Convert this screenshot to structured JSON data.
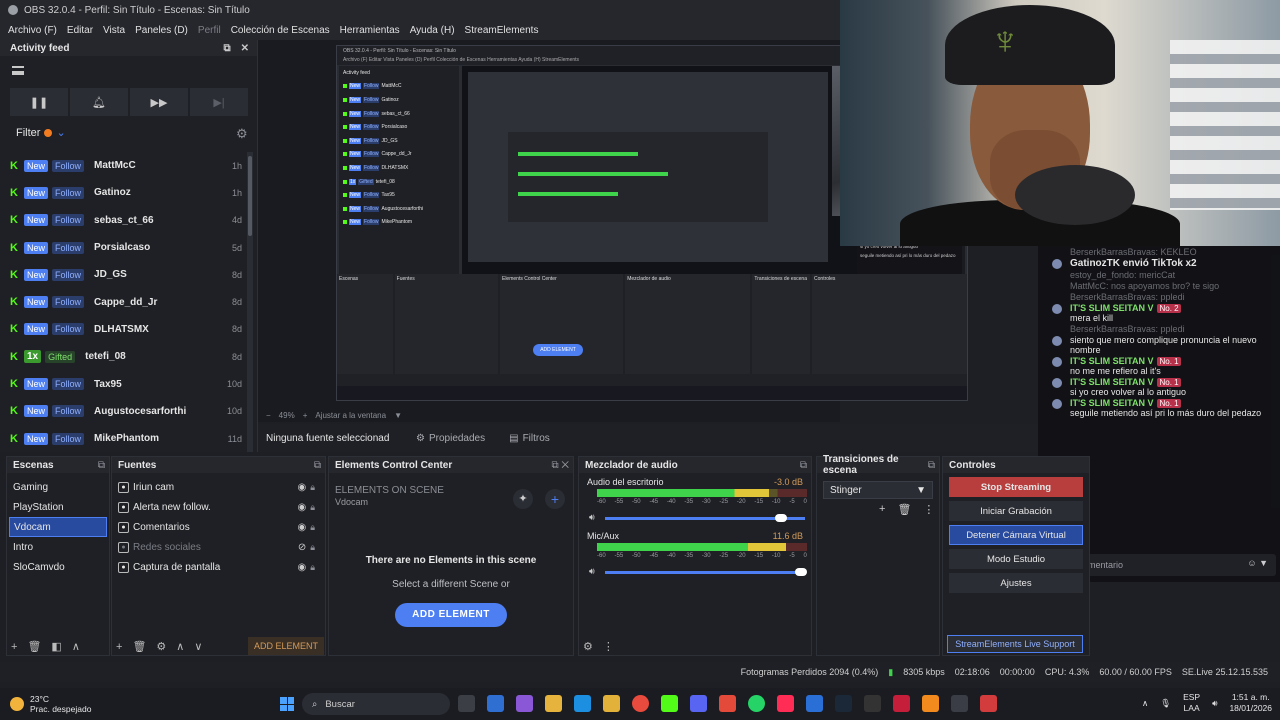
{
  "window": {
    "title": "OBS 32.0.4 - Perfil: Sin Título - Escenas: Sin Título"
  },
  "menu": [
    "Archivo (F)",
    "Editar",
    "Vista",
    "Paneles (D)",
    "Perfil",
    "Colección de Escenas",
    "Herramientas",
    "Ayuda (H)",
    "StreamElements"
  ],
  "activity": {
    "title": "Activity feed",
    "filter_label": "Filter",
    "items": [
      {
        "tag1": "New",
        "tag2": "Follow",
        "name": "MattMcC",
        "time": "1h"
      },
      {
        "tag1": "New",
        "tag2": "Follow",
        "name": "Gatinoz",
        "time": "1h"
      },
      {
        "tag1": "New",
        "tag2": "Follow",
        "name": "sebas_ct_66",
        "time": "4d"
      },
      {
        "tag1": "New",
        "tag2": "Follow",
        "name": "Porsialcaso",
        "time": "5d"
      },
      {
        "tag1": "New",
        "tag2": "Follow",
        "name": "JD_GS",
        "time": "8d"
      },
      {
        "tag1": "New",
        "tag2": "Follow",
        "name": "Cappe_dd_Jr",
        "time": "8d"
      },
      {
        "tag1": "New",
        "tag2": "Follow",
        "name": "DLHATSMX",
        "time": "8d"
      },
      {
        "tag1": "1x",
        "tag2": "Gifted",
        "name": "tetefi_08",
        "time": "8d"
      },
      {
        "tag1": "New",
        "tag2": "Follow",
        "name": "Tax95",
        "time": "10d"
      },
      {
        "tag1": "New",
        "tag2": "Follow",
        "name": "Augustocesarforthi",
        "time": "10d"
      },
      {
        "tag1": "New",
        "tag2": "Follow",
        "name": "MikePhantom",
        "time": "11d"
      }
    ]
  },
  "zoom": {
    "level": "49%",
    "fit": "Ajustar a la ventana"
  },
  "sourcebar": {
    "label": "Ninguna fuente seleccionad",
    "properties": "Propiedades",
    "filters": "Filtros"
  },
  "scenes": {
    "title": "Escenas",
    "items": [
      "Gaming",
      "PlayStation",
      "Vdocam",
      "Intro",
      "SloCamvdo"
    ],
    "selected_index": 2
  },
  "sources": {
    "title": "Fuentes",
    "items": [
      {
        "label": "Iriun cam",
        "visible": true
      },
      {
        "label": "Alerta new follow.",
        "visible": true
      },
      {
        "label": "Comentarios",
        "visible": true
      },
      {
        "label": "Redes sociales",
        "visible": false
      },
      {
        "label": "Captura de pantalla",
        "visible": true
      }
    ],
    "add_element": "ADD ELEMENT"
  },
  "ecc": {
    "title": "Elements Control Center",
    "heading": "ELEMENTS ON SCENE",
    "scene": "Vdocam",
    "empty": "There are no Elements in this scene",
    "hint": "Select a different Scene or",
    "button": "ADD ELEMENT"
  },
  "mixer": {
    "title": "Mezclador de audio",
    "channels": [
      {
        "name": "Audio del escritorio",
        "db": "-3.0 dB",
        "level": 0.82,
        "volume": 0.88
      },
      {
        "name": "Mic/Aux",
        "db": "11.6 dB",
        "level": 0.9,
        "volume": 0.98
      }
    ],
    "ticks": [
      "-60",
      "-55",
      "-50",
      "-45",
      "-40",
      "-35",
      "-30",
      "-25",
      "-20",
      "-15",
      "-10",
      "-5",
      "0"
    ]
  },
  "transitions": {
    "title": "Transiciones de escena",
    "selected": "Stinger"
  },
  "controls": {
    "title": "Controles",
    "buttons": [
      "Stop Streaming",
      "Iniciar Grabación",
      "Detener Cámara Virtual",
      "Modo Estudio",
      "Ajustes"
    ],
    "live_support": "StreamElements Live Support"
  },
  "chat": {
    "messages": [
      {
        "user": "BerserkBarrasBravas:",
        "text": "KEKLEO",
        "faded": true
      },
      {
        "user": "GatinozTK envió TikTok",
        "text": "x2",
        "gift": true
      },
      {
        "user": "estoy_de_fondo:",
        "text": "mericCat",
        "faded": true
      },
      {
        "user": "MattMcC:",
        "text": "nos apoyamos bro? te sigo",
        "faded": true
      },
      {
        "user": "BerserkBarrasBravas:",
        "text": "ppledi",
        "faded": true
      },
      {
        "user": "IT'S SLIM SEITAN V",
        "badge": "No. 2",
        "text": "mera el kill"
      },
      {
        "user": "BerserkBarrasBravas:",
        "text": "ppledi",
        "faded": true
      },
      {
        "user": "",
        "text": "siento que mero complique pronuncia el nuevo nombre"
      },
      {
        "user": "IT'S SLIM SEITAN V",
        "badge": "No. 1",
        "text": "no me me refiero al it's"
      },
      {
        "user": "IT'S SLIM SEITAN V",
        "badge": "No. 1",
        "text": "si yo creo volver al lo antiguo"
      },
      {
        "user": "IT'S SLIM SEITAN V",
        "badge": "No. 1",
        "text": "seguile metiendo así pri lo más duro del pedazo"
      }
    ],
    "input_placeholder": "Añadir comentario"
  },
  "status": {
    "dropped": "Fotogramas Perdidos 2094 (0.4%)",
    "kbps": "8305 kbps",
    "live_time": "02:18:06",
    "rec_time": "00:00:00",
    "cpu": "CPU: 4.3%",
    "fps": "60.00 / 60.00 FPS",
    "version": "SE.Live 25.12.15.535"
  },
  "taskbar": {
    "temp": "23°C",
    "weather": "Prac. despejado",
    "search": "Buscar",
    "lang1": "ESP",
    "lang2": "LAA",
    "time": "1:51 a. m.",
    "date": "18/01/2026"
  },
  "nested": {
    "title": "OBS 32.0.4 - Perfil: Sin Título - Escenas: Sin Título",
    "menu": "Archivo (F)  Editar  Vista  Paneles (D)  Perfil  Colección de Escenas  Herramientas  Ayuda (H)  StreamElements",
    "feed_title": "Activity feed",
    "docks": [
      "Escenas",
      "Fuentes",
      "Elements Control Center",
      "Mezclador de audio",
      "Transiciones de escena",
      "Controles"
    ],
    "add": "ADD ELEMENT"
  },
  "colors": {
    "accent": "#4d7ef2",
    "kick_green": "#53fc18",
    "stream_red": "#b83d3d"
  }
}
